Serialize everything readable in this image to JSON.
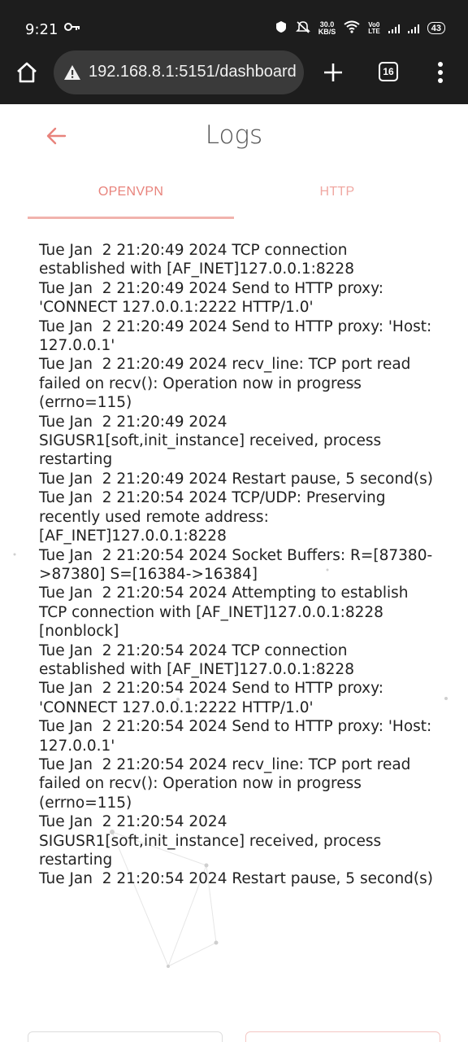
{
  "status_bar": {
    "time": "9:21",
    "net_speed_value": "30.0",
    "net_speed_unit": "KB/S",
    "network_label_top": "Vo0",
    "network_label_bottom": "LTE",
    "battery": "43"
  },
  "browser": {
    "url": "192.168.8.1:5151/dashboard",
    "tab_count": "16"
  },
  "page": {
    "title": "Logs",
    "tabs": [
      {
        "label": "OPENVPN",
        "active": true
      },
      {
        "label": "HTTP",
        "active": false
      }
    ]
  },
  "log_lines": [
    "Tue Jan  2 21:20:49 2024 TCP connection established with [AF_INET]127.0.0.1:8228",
    "Tue Jan  2 21:20:49 2024 Send to HTTP proxy: 'CONNECT 127.0.0.1:2222 HTTP/1.0'",
    "Tue Jan  2 21:20:49 2024 Send to HTTP proxy: 'Host: 127.0.0.1'",
    "Tue Jan  2 21:20:49 2024 recv_line: TCP port read failed on recv(): Operation now in progress (errno=115)",
    "Tue Jan  2 21:20:49 2024 SIGUSR1[soft,init_instance] received, process restarting",
    "Tue Jan  2 21:20:49 2024 Restart pause, 5 second(s)",
    "Tue Jan  2 21:20:54 2024 TCP/UDP: Preserving recently used remote address: [AF_INET]127.0.0.1:8228",
    "Tue Jan  2 21:20:54 2024 Socket Buffers: R=[87380->87380] S=[16384->16384]",
    "Tue Jan  2 21:20:54 2024 Attempting to establish TCP connection with [AF_INET]127.0.0.1:8228 [nonblock]",
    "Tue Jan  2 21:20:54 2024 TCP connection established with [AF_INET]127.0.0.1:8228",
    "Tue Jan  2 21:20:54 2024 Send to HTTP proxy: 'CONNECT 127.0.0.1:2222 HTTP/1.0'",
    "Tue Jan  2 21:20:54 2024 Send to HTTP proxy: 'Host: 127.0.0.1'",
    "Tue Jan  2 21:20:54 2024 recv_line: TCP port read failed on recv(): Operation now in progress (errno=115)",
    "Tue Jan  2 21:20:54 2024 SIGUSR1[soft,init_instance] received, process restarting",
    "Tue Jan  2 21:20:54 2024 Restart pause, 5 second(s)"
  ],
  "colors": {
    "accent": "#e8837c",
    "bar_bg": "#1d1d1d"
  },
  "icons": {
    "home": "home-icon",
    "warning": "not-secure-warning-icon",
    "new_tab": "plus-icon",
    "menu": "more-vert-icon",
    "back": "arrow-left-icon"
  }
}
